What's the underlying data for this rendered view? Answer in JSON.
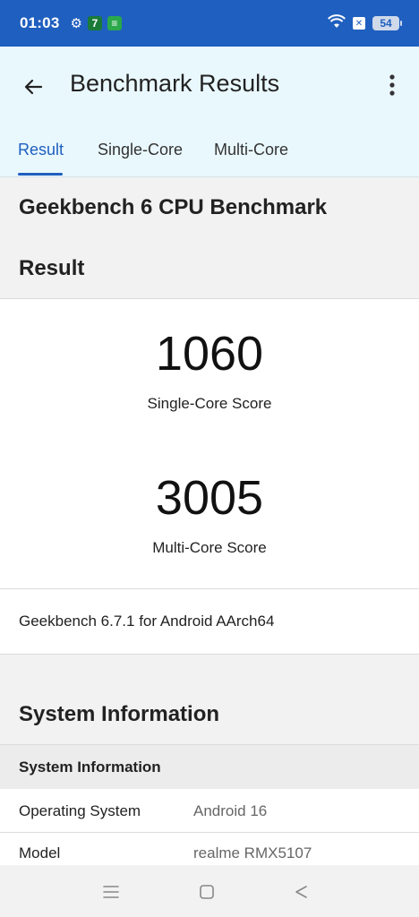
{
  "status_bar": {
    "time": "01:03",
    "badges": [
      "7",
      "≡"
    ],
    "battery": "54",
    "icons": [
      "gear-icon",
      "wifi-icon",
      "sim-x-icon",
      "battery-icon"
    ]
  },
  "app_bar": {
    "title": "Benchmark Results",
    "icons": [
      "back-arrow-icon",
      "more-vert-icon"
    ]
  },
  "tabs": [
    {
      "label": "Result",
      "active": true
    },
    {
      "label": "Single-Core",
      "active": false
    },
    {
      "label": "Multi-Core",
      "active": false
    }
  ],
  "main": {
    "benchmark_title": "Geekbench 6 CPU Benchmark",
    "result_heading": "Result",
    "single_core": {
      "value": "1060",
      "label": "Single-Core Score"
    },
    "multi_core": {
      "value": "3005",
      "label": "Multi-Core Score"
    },
    "version": "Geekbench 6.7.1 for Android AArch64",
    "system_heading": "System Information",
    "system_subheading": "System Information",
    "system_rows": [
      {
        "label": "Operating System",
        "value": "Android 16"
      },
      {
        "label": "Model",
        "value": "realme RMX5107"
      }
    ]
  },
  "colors": {
    "status_bar": "#1f5fbf",
    "accent": "#1f5fbf",
    "app_bar": "#e9f8fd"
  },
  "nav_bar": {
    "icons": [
      "menu-icon",
      "home-square-icon",
      "back-triangle-icon"
    ]
  }
}
